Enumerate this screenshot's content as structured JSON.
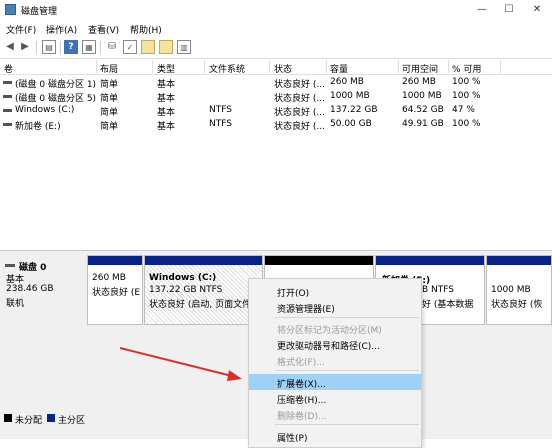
{
  "window": {
    "title": "磁盘管理",
    "minimize": "—",
    "maximize": "☐",
    "close": "✕"
  },
  "menu": [
    "文件(F)",
    "操作(A)",
    "查看(V)",
    "帮助(H)"
  ],
  "toolbar": {
    "back": "◀",
    "forward": "▶",
    "help": "?",
    "check": "✓"
  },
  "columns": [
    "卷",
    "布局",
    "类型",
    "文件系统",
    "状态",
    "容量",
    "可用空间",
    "% 可用"
  ],
  "volumes": [
    {
      "name": "(磁盘 0 磁盘分区 1)",
      "layout": "简单",
      "type": "基本",
      "fs": "",
      "status": "状态良好 (...",
      "capacity": "260 MB",
      "free": "260 MB",
      "pct": "100 %"
    },
    {
      "name": "(磁盘 0 磁盘分区 5)",
      "layout": "简单",
      "type": "基本",
      "fs": "",
      "status": "状态良好 (...",
      "capacity": "1000 MB",
      "free": "1000 MB",
      "pct": "100 %"
    },
    {
      "name": "Windows (C:)",
      "layout": "简单",
      "type": "基本",
      "fs": "NTFS",
      "status": "状态良好 (...",
      "capacity": "137.22 GB",
      "free": "64.52 GB",
      "pct": "47 %"
    },
    {
      "name": "新加卷 (E:)",
      "layout": "简单",
      "type": "基本",
      "fs": "NTFS",
      "status": "状态良好 (...",
      "capacity": "50.00 GB",
      "free": "49.91 GB",
      "pct": "100 %"
    }
  ],
  "disk": {
    "name": "磁盘 0",
    "type": "基本",
    "size": "238.46 GB",
    "state": "联机"
  },
  "partitions": [
    {
      "title": "",
      "line1": "260 MB",
      "line2": "状态良好 (E"
    },
    {
      "title": "Windows (C:)",
      "line1": "137.22 GB NTFS",
      "line2": "状态良好 (启动, 页面文件,"
    },
    {
      "title": "",
      "line1": "",
      "line2": ""
    },
    {
      "title": "新加卷 (E:)",
      "line1": "B NTFS",
      "line2": "好 (基本数据"
    },
    {
      "title": "",
      "line1": "1000 MB",
      "line2": "状态良好 (恢"
    }
  ],
  "legend": [
    {
      "label": "未分配",
      "color": "#000000"
    },
    {
      "label": "主分区",
      "color": "#0a2387"
    }
  ],
  "context_menu": [
    {
      "label": "打开(O)",
      "enabled": true
    },
    {
      "label": "资源管理器(E)",
      "enabled": true
    },
    {
      "label": "将分区标记为活动分区(M)",
      "enabled": false
    },
    {
      "label": "更改驱动器号和路径(C)...",
      "enabled": true
    },
    {
      "label": "格式化(F)...",
      "enabled": false
    },
    {
      "label": "扩展卷(X)...",
      "enabled": true,
      "highlighted": true
    },
    {
      "label": "压缩卷(H)...",
      "enabled": true
    },
    {
      "label": "删除卷(D)...",
      "enabled": false
    },
    {
      "label": "属性(P)",
      "enabled": true
    }
  ]
}
